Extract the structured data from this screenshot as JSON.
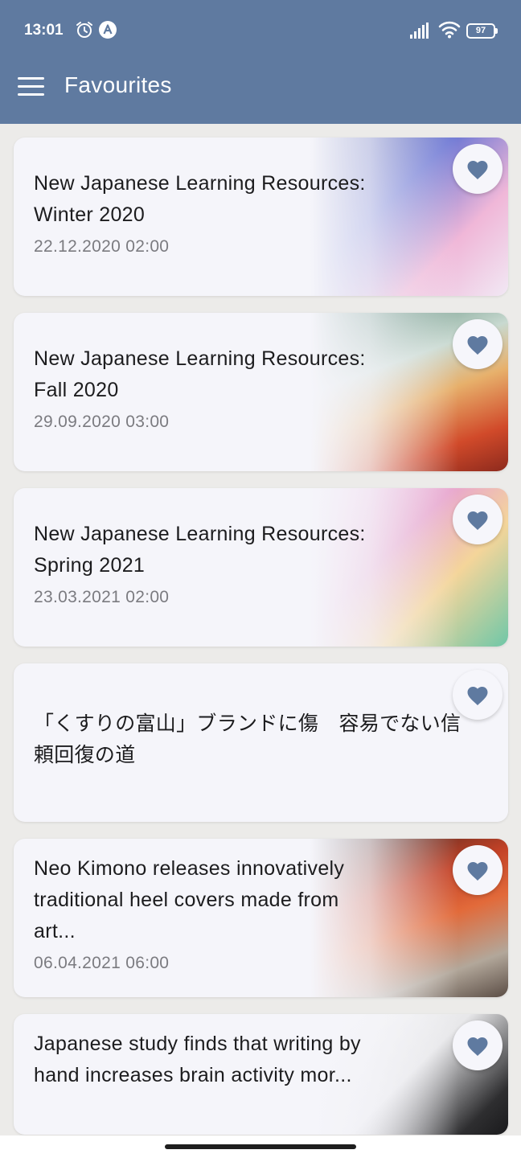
{
  "status_bar": {
    "time": "13:01",
    "battery": "97",
    "icons": [
      "alarm-icon",
      "app-a-icon",
      "signal-icon",
      "wifi-icon",
      "battery-icon"
    ]
  },
  "app_bar": {
    "title": "Favourites",
    "menu_icon": "hamburger-menu-icon",
    "background_color": "#5f7aa0"
  },
  "articles": [
    {
      "headline": "New Japanese Learning Resources: Winter 2020",
      "date": "22.12.2020 02:00",
      "favourited": true
    },
    {
      "headline": "New Japanese Learning Resources: Fall 2020",
      "date": "29.09.2020 03:00",
      "favourited": true
    },
    {
      "headline": "New Japanese Learning Resources: Spring 2021",
      "date": "23.03.2021 02:00",
      "favourited": true
    },
    {
      "headline": "「くすりの富山」ブランドに傷　容易でない信頼回復の道",
      "date": "",
      "favourited": true
    },
    {
      "headline": "Neo Kimono releases innovatively traditional heel covers made from art...",
      "date": "06.04.2021 06:00",
      "favourited": true
    },
    {
      "headline": "Japanese study finds that writing by hand increases brain activity mor...",
      "date": "",
      "favourited": true
    }
  ],
  "colors": {
    "heart": "#5f7aa0",
    "card_background": "#f5f5fa",
    "page_background": "#ecebe9"
  }
}
